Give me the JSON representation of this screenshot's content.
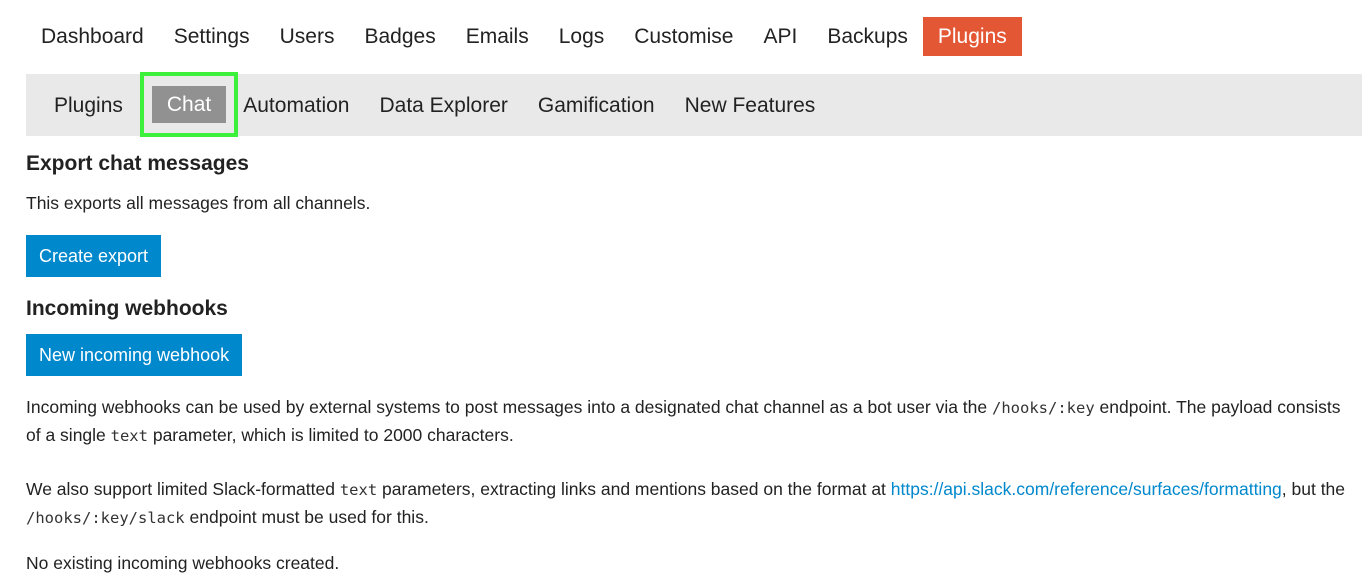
{
  "top_nav": {
    "items": [
      {
        "label": "Dashboard",
        "active": false
      },
      {
        "label": "Settings",
        "active": false
      },
      {
        "label": "Users",
        "active": false
      },
      {
        "label": "Badges",
        "active": false
      },
      {
        "label": "Emails",
        "active": false
      },
      {
        "label": "Logs",
        "active": false
      },
      {
        "label": "Customise",
        "active": false
      },
      {
        "label": "API",
        "active": false
      },
      {
        "label": "Backups",
        "active": false
      },
      {
        "label": "Plugins",
        "active": true
      }
    ]
  },
  "sub_nav": {
    "items": [
      {
        "label": "Plugins"
      },
      {
        "label": "Chat",
        "active": true
      },
      {
        "label": "Automation"
      },
      {
        "label": "Data Explorer"
      },
      {
        "label": "Gamification"
      },
      {
        "label": "New Features"
      }
    ]
  },
  "export": {
    "title": "Export chat messages",
    "description": "This exports all messages from all channels.",
    "button_label": "Create export"
  },
  "webhooks": {
    "title": "Incoming webhooks",
    "button_label": "New incoming webhook",
    "desc1_a": "Incoming webhooks can be used by external systems to post messages into a designated chat channel as a bot user via the ",
    "desc1_code1": "/hooks/:key",
    "desc1_b": " endpoint. The payload consists of a single ",
    "desc1_code2": "text",
    "desc1_c": " parameter, which is limited to 2000 characters.",
    "desc2_a": "We also support limited Slack-formatted ",
    "desc2_code1": "text",
    "desc2_b": " parameters, extracting links and mentions based on the format at ",
    "desc2_link": "https://api.slack.com/reference/surfaces/formatting",
    "desc2_c": ", but the ",
    "desc2_code2": "/hooks/:key/slack",
    "desc2_d": " endpoint must be used for this.",
    "empty_note": "No existing incoming webhooks created."
  },
  "colors": {
    "accent": "#e45735",
    "primary_button": "#0088cc",
    "link": "#0088cc",
    "subnav_bg": "#e9e9e9",
    "subnav_active": "#919191",
    "highlight_outline": "#3cf03c"
  }
}
